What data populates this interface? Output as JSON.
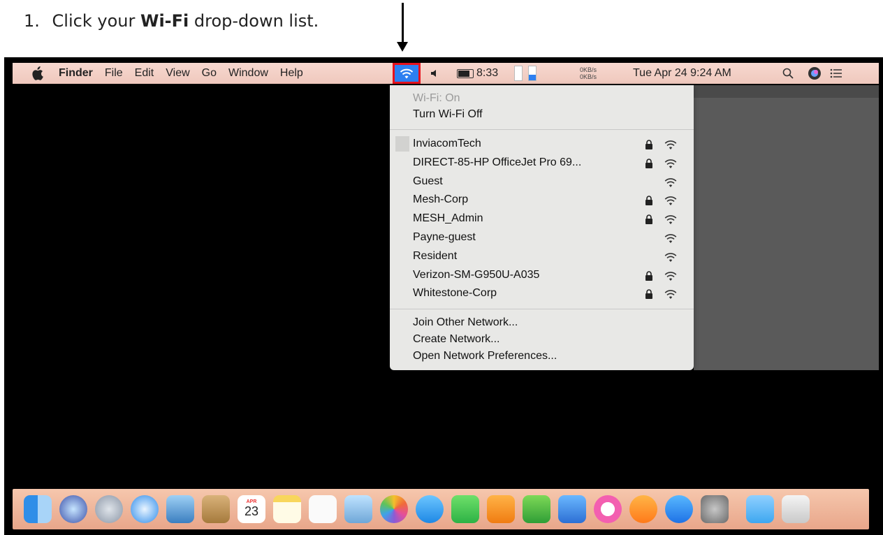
{
  "instruction": {
    "number": "1.",
    "prefix": "Click your",
    "bold": "Wi-Fi",
    "suffix": "drop-down list."
  },
  "menubar": {
    "apple_icon": "apple-icon",
    "items": [
      "Finder",
      "File",
      "Edit",
      "View",
      "Go",
      "Window",
      "Help"
    ],
    "wifi_icon": "wifi-icon",
    "volume_icon": "speaker-icon",
    "battery_time": "8:33",
    "net_up": "0KB/s",
    "net_down": "0KB/s",
    "datetime": "Tue Apr 24  9:24 AM",
    "search_icon": "magnifier-icon",
    "siri_icon": "siri-icon",
    "list_icon": "list-icon"
  },
  "wifi_menu": {
    "status": "Wi-Fi: On",
    "toggle": "Turn Wi-Fi Off",
    "networks": [
      {
        "name": "InviacomTech",
        "locked": true
      },
      {
        "name": "DIRECT-85-HP OfficeJet Pro 69...",
        "locked": true
      },
      {
        "name": "Guest",
        "locked": false
      },
      {
        "name": "Mesh-Corp",
        "locked": true
      },
      {
        "name": "MESH_Admin",
        "locked": true
      },
      {
        "name": "Payne-guest",
        "locked": false
      },
      {
        "name": "Resident",
        "locked": false
      },
      {
        "name": "Verizon-SM-G950U-A035",
        "locked": true
      },
      {
        "name": "Whitestone-Corp",
        "locked": true
      }
    ],
    "join_other": "Join Other Network...",
    "create": "Create Network...",
    "open_prefs": "Open Network Preferences..."
  },
  "dock": {
    "calendar_day": "23",
    "calendar_month": "APR",
    "icons": [
      "finder-icon",
      "siri-icon",
      "launchpad-icon",
      "safari-icon",
      "mail-icon",
      "contacts-icon",
      "calendar-icon",
      "notes-icon",
      "reminders-icon",
      "preview-icon",
      "photos-icon",
      "messages-icon",
      "facetime-icon",
      "pages-icon",
      "numbers-icon",
      "keynote-icon",
      "itunes-icon",
      "ibooks-icon",
      "app-store-icon",
      "system-preferences-icon",
      "folder-icon",
      "trash-icon"
    ]
  },
  "colors": {
    "menubar": "#efc8bd",
    "wifi_highlight": "#2d7ff0",
    "callout_border": "#e8111b",
    "menu_bg": "#e8e8e6"
  }
}
